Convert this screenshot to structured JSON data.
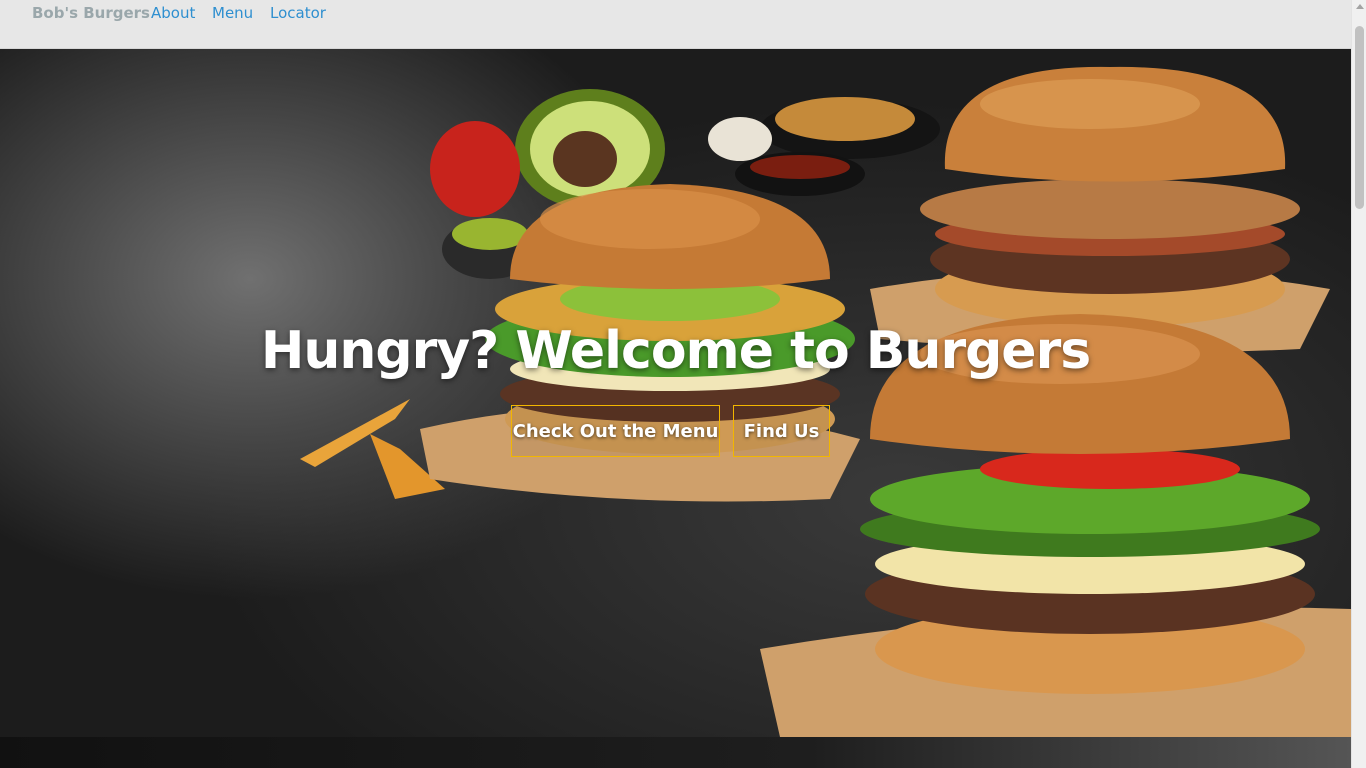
{
  "nav": {
    "brand": "Bob's Burgers",
    "links": [
      "About",
      "Menu",
      "Locator"
    ]
  },
  "hero": {
    "title": "Hungry? Welcome to Burgers",
    "buttons": [
      "Check Out the Menu",
      "Find Us"
    ],
    "background": "burger-photo"
  },
  "colors": {
    "brand": "#9aa7ab",
    "link": "#2e8fd0",
    "button_border": "#f2b600",
    "navbar_bg": "#e7e7e7"
  }
}
